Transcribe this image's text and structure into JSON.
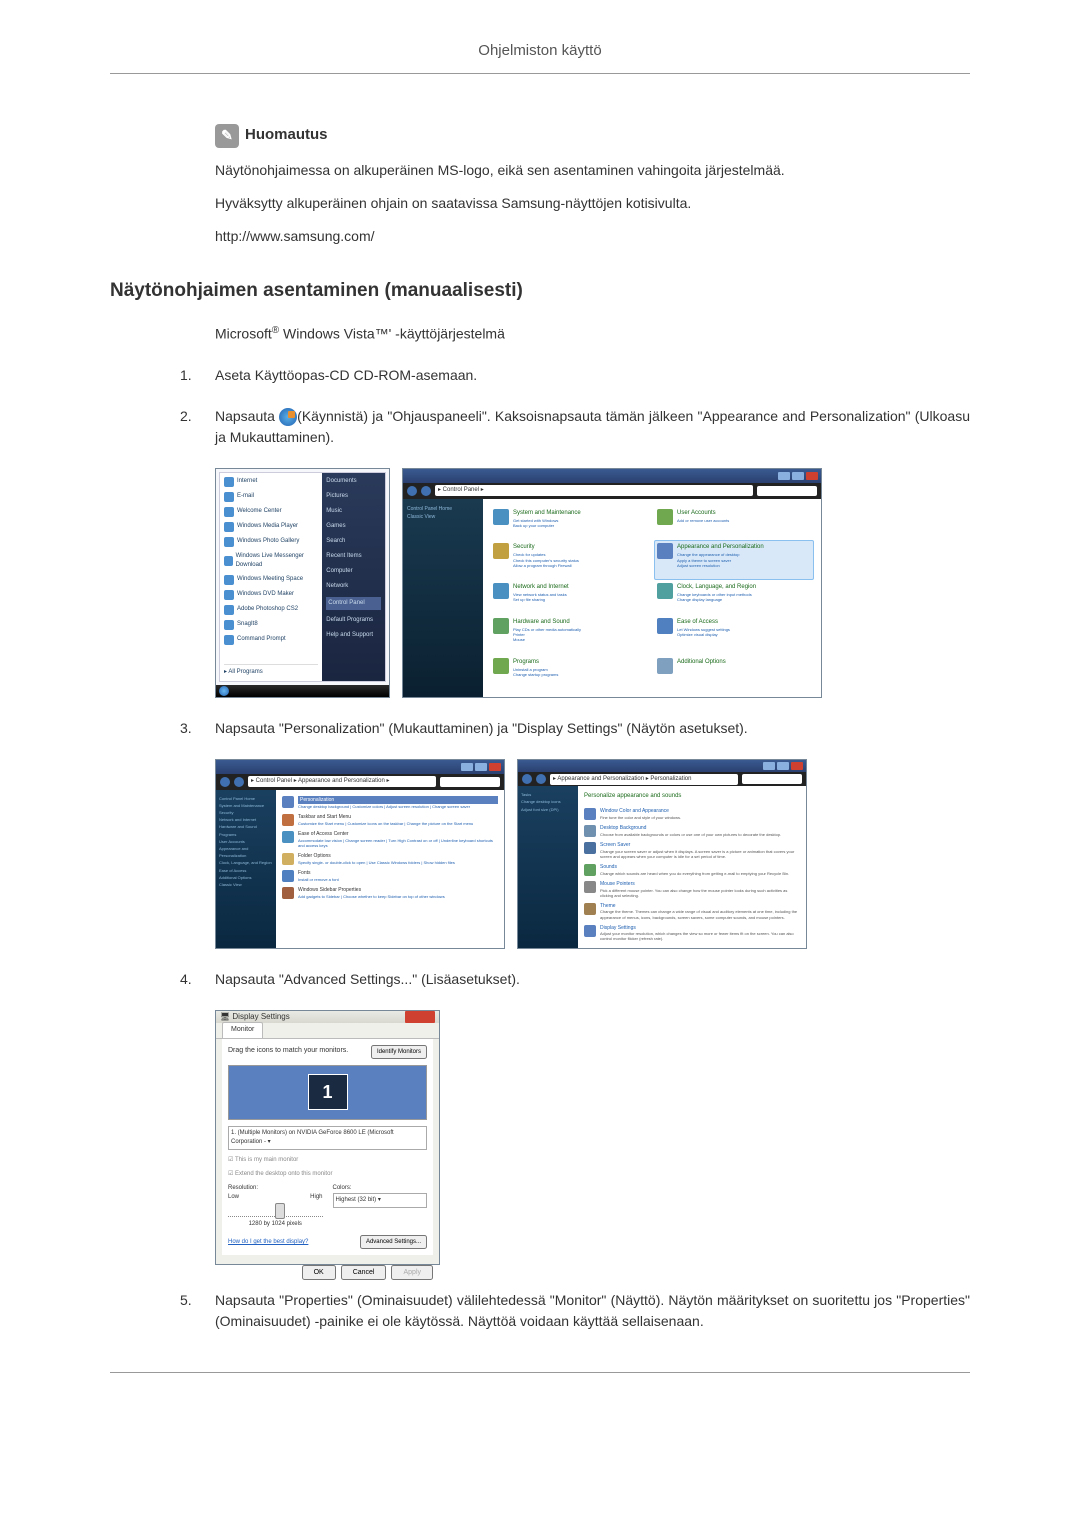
{
  "page_header": "Ohjelmiston käyttö",
  "notice": {
    "title": "Huomautus",
    "p1": "Näytönohjaimessa on alkuperäinen MS-logo, eikä sen asentaminen vahingoita järjestelmää.",
    "p2": "Hyväksytty alkuperäinen ohjain on saatavissa Samsung-näyttöjen kotisivulta.",
    "p3": "http://www.samsung.com/"
  },
  "section": {
    "title": "Näytönohjaimen asentaminen (manuaalisesti)",
    "subtitle_prefix": "Microsoft",
    "subtitle_mid": " Windows Vista™' -käyttöjärjestelmä"
  },
  "steps": {
    "s1": "Aseta Käyttöopas-CD CD-ROM-asemaan.",
    "s2a": "Napsauta ",
    "s2b": "(Käynnistä) ja \"Ohjauspaneeli\". Kaksoisnapsauta tämän jälkeen \"Appearance and Personalization\" (Ulkoasu ja Mukauttaminen).",
    "s3": "Napsauta \"Personalization\" (Mukauttaminen) ja \"Display Settings\" (Näytön asetukset).",
    "s4": "Napsauta \"Advanced Settings...\" (Lisäasetukset).",
    "s5": "Napsauta \"Properties\" (Ominaisuudet) välilehtedessä \"Monitor\" (Näyttö). Näytön määritykset on suoritettu jos \"Properties\" (Ominaisuudet) -painike ei ole käytössä. Näyttöä voidaan käyttää sellaisenaan."
  },
  "start_menu": {
    "items": [
      "Internet",
      "E-mail",
      "Welcome Center",
      "Windows Media Player",
      "Windows Photo Gallery",
      "Windows Live Messenger Download",
      "Windows Meeting Space",
      "Windows DVD Maker",
      "Adobe Photoshop CS2",
      "SnagIt8",
      "Command Prompt"
    ],
    "all": "All Programs",
    "right": [
      "Documents",
      "Pictures",
      "Music",
      "Games",
      "Search",
      "Recent Items",
      "Computer",
      "Network",
      "Control Panel",
      "Default Programs",
      "Help and Support"
    ],
    "highlight": "Control Panel"
  },
  "control_panel": {
    "addr": "▸ Control Panel ▸",
    "side": [
      "Control Panel Home",
      "Classic View"
    ],
    "items": [
      {
        "t": "System and Maintenance",
        "s": "Get started with Windows\nBack up your computer",
        "c": "#4a90c0"
      },
      {
        "t": "User Accounts",
        "s": "Add or remove user accounts",
        "c": "#70a850"
      },
      {
        "t": "Security",
        "s": "Check for updates\nCheck this computer's security status\nAllow a program through Firewall",
        "c": "#c0a040"
      },
      {
        "t": "Appearance and Personalization",
        "s": "Change the appearance of desktop\nApply a theme to screen saver\nAdjust screen resolution",
        "c": "#5a80c0",
        "hl": true
      },
      {
        "t": "Network and Internet",
        "s": "View network status and tasks\nSet up file sharing",
        "c": "#4a90c0"
      },
      {
        "t": "Clock, Language, and Region",
        "s": "Change keyboards or other input methods\nChange display language",
        "c": "#50a0a0"
      },
      {
        "t": "Hardware and Sound",
        "s": "Play CDs or other media automatically\nPrinter\nMouse",
        "c": "#60a060"
      },
      {
        "t": "Ease of Access",
        "s": "Let Windows suggest settings\nOptimize visual display",
        "c": "#5080c0"
      },
      {
        "t": "Programs",
        "s": "Uninstall a program\nChange startup programs",
        "c": "#70a850"
      },
      {
        "t": "Additional Options",
        "s": "",
        "c": "#80a0c0"
      }
    ]
  },
  "personalize_left": {
    "addr": "▸ Control Panel ▸ Appearance and Personalization ▸",
    "side": [
      "Control Panel Home",
      "System and Maintenance",
      "Security",
      "Network and Internet",
      "Hardware and Sound",
      "Programs",
      "User Accounts",
      "Appearance and Personalization",
      "Clock, Language, and Region",
      "Ease of Access",
      "Additional Options",
      "Classic View"
    ],
    "items": [
      {
        "t": "Personalization",
        "s": "Change desktop background | Customize colors | Adjust screen resolution | Change screen saver",
        "c": "#5a80c0",
        "hl": true
      },
      {
        "t": "Taskbar and Start Menu",
        "s": "Customize the Start menu | Customize icons on the taskbar | Change the picture on the Start menu",
        "c": "#c07040"
      },
      {
        "t": "Ease of Access Center",
        "s": "Accommodate low vision | Change screen reader | Turn High Contrast on or off | Underline keyboard shortcuts and access keys",
        "c": "#4a90c0"
      },
      {
        "t": "Folder Options",
        "s": "Specify single- or double-click to open | Use Classic Windows folders | Show hidden files",
        "c": "#d0b060"
      },
      {
        "t": "Fonts",
        "s": "Install or remove a font",
        "c": "#5080c0"
      },
      {
        "t": "Windows Sidebar Properties",
        "s": "Add gadgets to Sidebar | Choose whether to keep Sidebar on top of other windows",
        "c": "#a06040"
      }
    ]
  },
  "personalize_right": {
    "addr": "▸ Appearance and Personalization ▸ Personalization",
    "side": [
      "Tasks",
      "Change desktop icons",
      "Adjust font size (DPI)"
    ],
    "title": "Personalize appearance and sounds",
    "items": [
      {
        "t": "Window Color and Appearance",
        "s": "Fine tune the color and style of your windows.",
        "c": "#5a80c0"
      },
      {
        "t": "Desktop Background",
        "s": "Choose from available backgrounds or colors or use one of your own pictures to decorate the desktop.",
        "c": "#7090b0"
      },
      {
        "t": "Screen Saver",
        "s": "Change your screen saver or adjust when it displays. A screen saver is a picture or animation that covers your screen and appears when your computer is idle for a set period of time.",
        "c": "#4a70a0"
      },
      {
        "t": "Sounds",
        "s": "Change which sounds are heard when you do everything from getting e-mail to emptying your Recycle Bin.",
        "c": "#60a060"
      },
      {
        "t": "Mouse Pointers",
        "s": "Pick a different mouse pointer. You can also change how the mouse pointer looks during such activities as clicking and selecting.",
        "c": "#888"
      },
      {
        "t": "Theme",
        "s": "Change the theme. Themes can change a wide range of visual and auditory elements at one time, including the appearance of menus, icons, backgrounds, screen savers, some computer sounds, and mouse pointers.",
        "c": "#a08050"
      },
      {
        "t": "Display Settings",
        "s": "Adjust your monitor resolution, which changes the view so more or fewer items fit on the screen. You can also control monitor flicker (refresh rate).",
        "c": "#5a80c0"
      }
    ]
  },
  "display_settings": {
    "title": "Display Settings",
    "tab": "Monitor",
    "drag": "Drag the icons to match your monitors.",
    "identify": "Identify Monitors",
    "monitor_num": "1",
    "select": "1. (Multiple Monitors) on NVIDIA GeForce 8600 LE (Microsoft Corporation - ▾",
    "chk1": "☑ This is my main monitor",
    "chk2": "☑ Extend the desktop onto this monitor",
    "res_label": "Resolution:",
    "low": "Low",
    "high": "High",
    "res_value": "1280 by 1024 pixels",
    "color_label": "Colors:",
    "color_value": "Highest (32 bit)   ▾",
    "help": "How do I get the best display?",
    "adv": "Advanced Settings...",
    "ok": "OK",
    "cancel": "Cancel",
    "apply": "Apply"
  }
}
